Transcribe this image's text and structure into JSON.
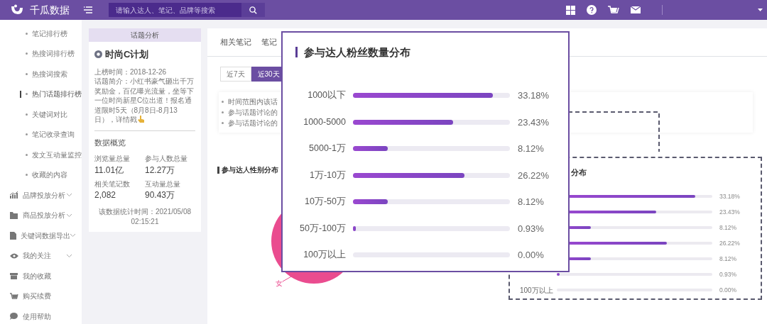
{
  "topbar": {
    "brand": "千瓜数据",
    "search": {
      "placeholder": "请输入达人、笔记、品牌等搜索"
    }
  },
  "sidebar": {
    "items": [
      {
        "label": "笔记排行榜",
        "kind": "sub",
        "selected": false
      },
      {
        "label": "热搜词排行榜",
        "kind": "sub",
        "selected": false
      },
      {
        "label": "热搜词搜索",
        "kind": "sub",
        "selected": false
      },
      {
        "label": "热门话题排行榜",
        "kind": "sub",
        "selected": true
      },
      {
        "label": "关键词对比",
        "kind": "sub",
        "selected": false
      },
      {
        "label": "笔记收录查询",
        "kind": "sub",
        "selected": false
      },
      {
        "label": "发文互动量监控",
        "kind": "sub",
        "selected": false
      },
      {
        "label": "收藏的内容",
        "kind": "sub",
        "selected": false
      },
      {
        "label": "品牌投放分析",
        "kind": "group",
        "expanded": false
      },
      {
        "label": "商品投放分析",
        "kind": "group",
        "expanded": false
      },
      {
        "label": "关键词数据导出",
        "kind": "group",
        "expanded": false
      },
      {
        "label": "我的关注",
        "kind": "group",
        "expanded": false
      },
      {
        "label": "我的收藏",
        "kind": "link"
      },
      {
        "label": "购买续费",
        "kind": "link"
      },
      {
        "label": "使用帮助",
        "kind": "link"
      }
    ]
  },
  "topic_card": {
    "header": "话题分析",
    "title": "时尚C计划",
    "listed": "上榜时间：2018-12-26",
    "intro": "话题简介：小红书豪气砸出千万奖励金，百亿曝光流量，坐等下一位时尚新星C位出道！报名通道限时5天（8月8日-8月13日），详情戳",
    "stats_heading": "数据概览",
    "stats": [
      {
        "label": "浏览量总量",
        "value": "11.01亿"
      },
      {
        "label": "参与人数总量",
        "value": "12.27万"
      },
      {
        "label": "相关笔记数",
        "value": "2,082"
      },
      {
        "label": "互动量总量",
        "value": "90.43万"
      }
    ],
    "updated": "该数据统计时间：2021/05/08 02:15:21"
  },
  "main": {
    "tabs": [
      {
        "label": "相关笔记",
        "selected": false
      },
      {
        "label": "笔记",
        "selected": false
      }
    ],
    "ranges": [
      {
        "label": "近7天",
        "selected": false
      },
      {
        "label": "近30天",
        "selected": true
      }
    ],
    "summary": [
      "时间范围内该话",
      "参与话题讨论的",
      "参与话题讨论的"
    ],
    "gender": {
      "title": "参与达人性别分布",
      "female_label": "女"
    },
    "fans_chart": {
      "title": "分布",
      "rows": [
        {
          "level": 0.89,
          "reading": "33.18%"
        },
        {
          "level": 0.64,
          "reading": "23.43%"
        },
        {
          "level": 0.22,
          "reading": "8.12%"
        },
        {
          "level": 0.71,
          "reading": "26.22%"
        },
        {
          "level": 0.22,
          "reading": "8.12%"
        },
        {
          "level": 0.02,
          "reading": "0.93%"
        },
        {
          "label": "100万以上",
          "level": 0,
          "reading": "0.00%"
        }
      ]
    }
  },
  "popup": {
    "title": "参与达人粉丝数量分布",
    "rows": [
      {
        "label": "1000以下",
        "level": 0.89,
        "reading": "33.18%"
      },
      {
        "label": "1000-5000",
        "level": 0.64,
        "reading": "23.43%"
      },
      {
        "label": "5000-1万",
        "level": 0.22,
        "reading": "8.12%"
      },
      {
        "label": "1万-10万",
        "level": 0.71,
        "reading": "26.22%"
      },
      {
        "label": "10万-50万",
        "level": 0.22,
        "reading": "8.12%"
      },
      {
        "label": "50万-100万",
        "level": 0.02,
        "reading": "0.93%"
      },
      {
        "label": "100万以上",
        "level": 0,
        "reading": "0.00%"
      }
    ]
  }
}
